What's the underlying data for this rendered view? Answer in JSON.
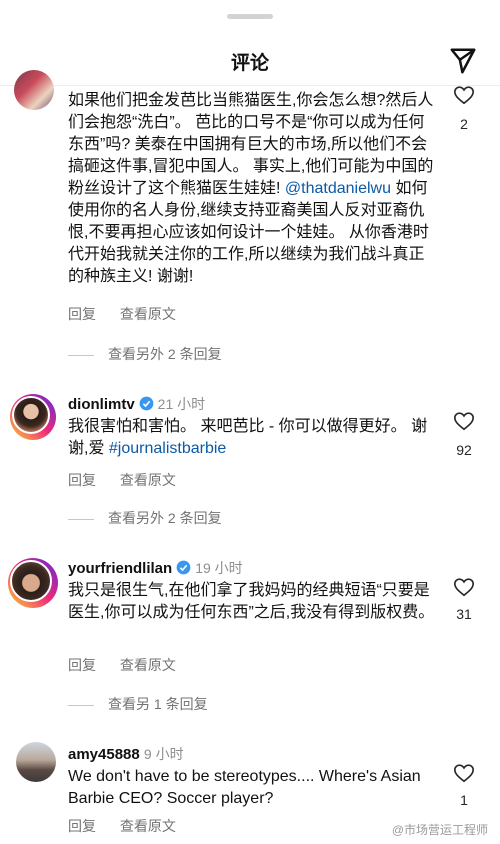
{
  "header": {
    "title": "评论"
  },
  "comments": [
    {
      "text": "如果他们把金发芭比当熊猫医生,你会怎么想?然后人们会抱怨“洗白”。 芭比的口号不是“你可以成为任何东西”吗? 美泰在中国拥有巨大的市场,所以他们不会搞砸这件事,冒犯中国人。 事实上,他们可能为中国的粉丝设计了这个熊猫医生娃娃!",
      "mention": "@thatdanielwu",
      "text_after": "如何使用你的名人身份,继续支持亚裔美国人反对亚裔仇恨,不要再担心应该如何设计一个娃娃。 从你香港时代开始我就关注你的工作,所以继续为我们战斗真正的种族主义! 谢谢!",
      "reply": "回复",
      "translate": "查看原文",
      "likes": "2",
      "view_replies": "查看另外 2 条回复"
    },
    {
      "username": "dionlimtv",
      "time": "21 小时",
      "text": "我很害怕和害怕。 来吧芭比 - 你可以做得更好。 谢谢,爱",
      "hashtag": "#journalistbarbie",
      "reply": "回复",
      "translate": "查看原文",
      "likes": "92",
      "view_replies": "查看另外 2 条回复"
    },
    {
      "username": "yourfriendlilan",
      "time": "19 小时",
      "text": "我只是很生气,在他们拿了我妈妈的经典短语“只要是医生,你可以成为任何东西”之后,我没有得到版权费。",
      "reply": "回复",
      "translate": "查看原文",
      "likes": "31",
      "view_replies": "查看另 1 条回复"
    },
    {
      "username": "amy45888",
      "time": "9 小时",
      "text": "We don't have to be stereotypes.... Where's Asian Barbie CEO? Soccer player?",
      "reply": "回复",
      "translate": "查看原文",
      "likes": "1"
    }
  ],
  "watermark": "@市场营运工程师",
  "colors": {
    "verified": "#3897f0",
    "link": "#0b5aa8",
    "muted": "#737373"
  }
}
